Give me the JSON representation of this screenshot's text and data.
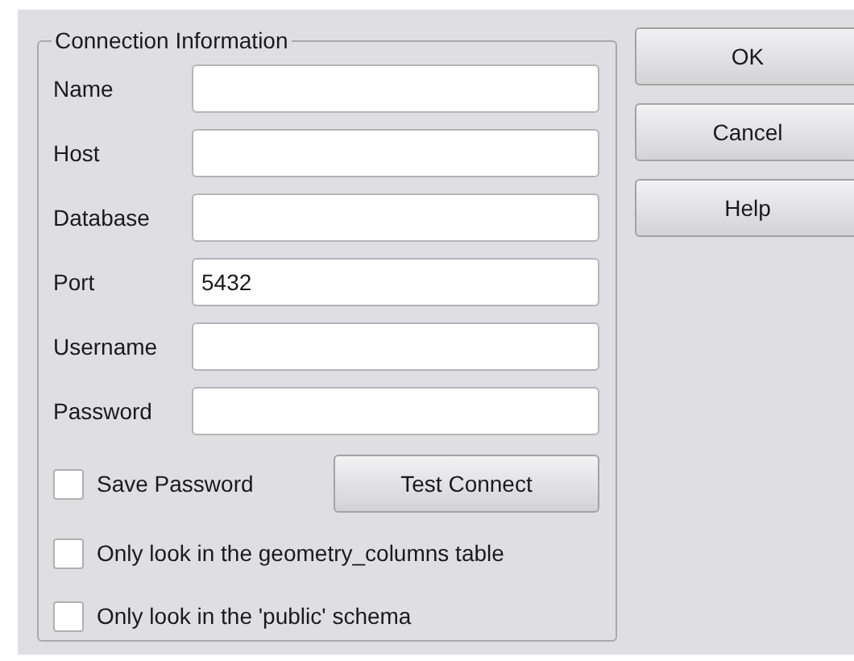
{
  "group": {
    "title": "Connection Information"
  },
  "fields": [
    {
      "label": "Name"
    },
    {
      "label": "Host"
    },
    {
      "label": "Database"
    },
    {
      "label": "Port",
      "value": "5432"
    },
    {
      "label": "Username"
    },
    {
      "label": "Password"
    }
  ],
  "save_password": {
    "label": "Save Password",
    "checked": false
  },
  "test_button": "Test Connect",
  "options": [
    {
      "label": "Only look in the geometry_columns table",
      "checked": false
    },
    {
      "label": "Only look in the 'public' schema",
      "checked": false
    }
  ],
  "buttons": [
    "OK",
    "Cancel",
    "Help"
  ]
}
